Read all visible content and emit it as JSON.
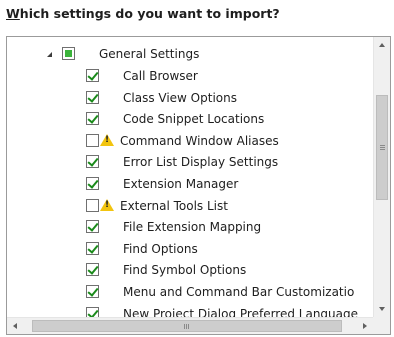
{
  "heading": {
    "accel": "W",
    "rest": "hich settings do you want to import?"
  },
  "tree": {
    "root": {
      "label": "General Settings",
      "state": "partial",
      "expanded": true
    },
    "items": [
      {
        "label": "Call Browser",
        "checked": true,
        "warning": false
      },
      {
        "label": "Class View Options",
        "checked": true,
        "warning": false
      },
      {
        "label": "Code Snippet Locations",
        "checked": true,
        "warning": false
      },
      {
        "label": "Command Window Aliases",
        "checked": false,
        "warning": true
      },
      {
        "label": "Error List Display Settings",
        "checked": true,
        "warning": false
      },
      {
        "label": "Extension Manager",
        "checked": true,
        "warning": false
      },
      {
        "label": "External Tools List",
        "checked": false,
        "warning": true
      },
      {
        "label": "File Extension Mapping",
        "checked": true,
        "warning": false
      },
      {
        "label": "Find Options",
        "checked": true,
        "warning": false
      },
      {
        "label": "Find Symbol Options",
        "checked": true,
        "warning": false
      },
      {
        "label": "Menu and Command Bar Customizatio",
        "checked": true,
        "warning": false
      },
      {
        "label": "New Project Dialog Preferred Language",
        "checked": true,
        "warning": false
      }
    ]
  },
  "icons": {
    "expander": "expanded-triangle-icon",
    "warning": "warning-icon",
    "warning_glyph": "!"
  }
}
